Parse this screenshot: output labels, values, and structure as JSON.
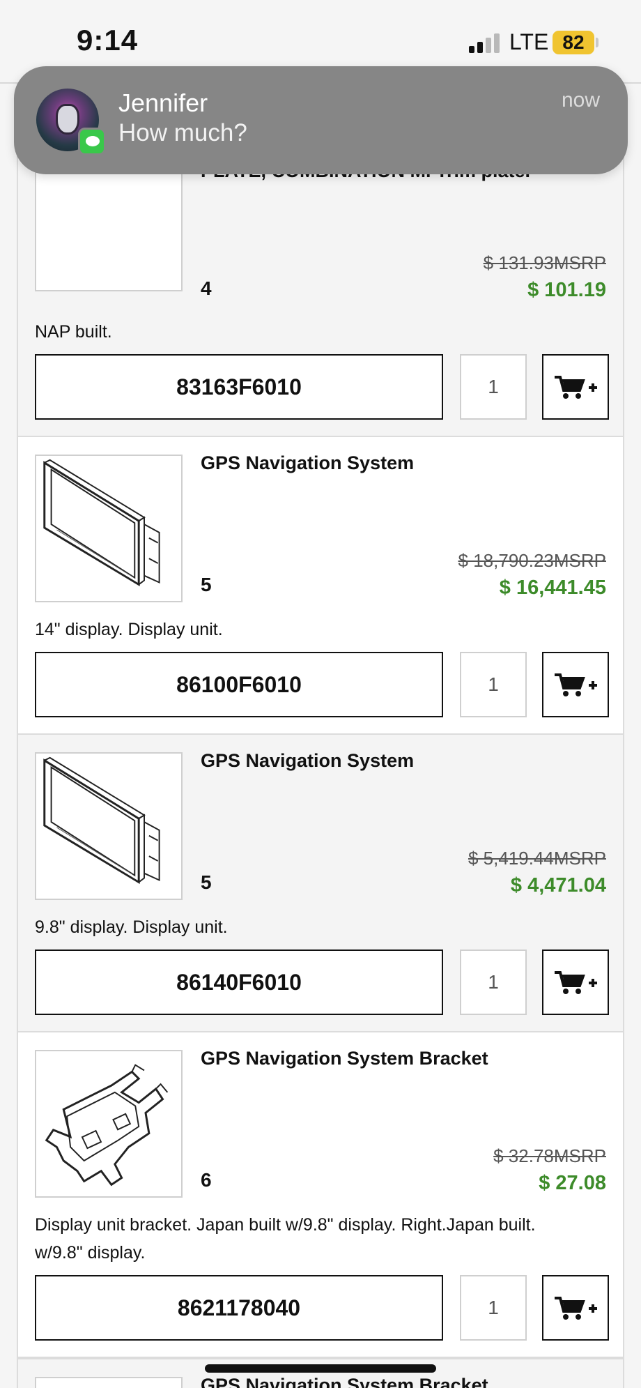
{
  "status_bar": {
    "time": "9:14",
    "network": "LTE",
    "battery": "82"
  },
  "notification": {
    "sender": "Jennifer",
    "message": "How much?",
    "time": "now"
  },
  "parts": [
    {
      "name": "PLATE, COMBINATION M. Trim plate.",
      "ref": "4",
      "msrp": "$ 131.93MSRP",
      "price": "$ 101.19",
      "description": "NAP built.",
      "part_number": "83163F6010",
      "quantity": "1",
      "image_icon": "trim-plate-icon"
    },
    {
      "name": "GPS Navigation System",
      "ref": "5",
      "msrp": "$ 18,790.23MSRP",
      "price": "$ 16,441.45",
      "description": "14\" display. Display unit.",
      "part_number": "86100F6010",
      "quantity": "1",
      "image_icon": "display-unit-icon"
    },
    {
      "name": "GPS Navigation System",
      "ref": "5",
      "msrp": "$ 5,419.44MSRP",
      "price": "$ 4,471.04",
      "description": "9.8\" display. Display unit.",
      "part_number": "86140F6010",
      "quantity": "1",
      "image_icon": "display-unit-icon"
    },
    {
      "name": "GPS Navigation System Bracket",
      "ref": "6",
      "msrp": "$ 32.78MSRP",
      "price": "$ 27.08",
      "description": "Display unit bracket. Japan built w/9.8\" display. Right.Japan built. w/9.8\" display.",
      "part_number": "8621178040",
      "quantity": "1",
      "image_icon": "bracket-icon"
    },
    {
      "name": "GPS Navigation System Bracket",
      "image_icon": "bracket-icon"
    }
  ],
  "cart_icon": "cart-plus-icon",
  "colors": {
    "price_green": "#3d8b2a",
    "notification_bg": "#868686",
    "battery": "#f0c430"
  }
}
